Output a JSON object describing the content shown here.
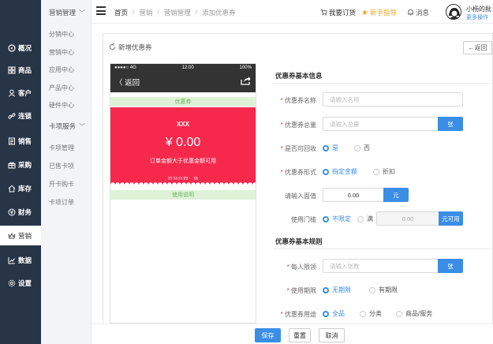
{
  "sidebar": {
    "items": [
      {
        "label": "概况",
        "icon": "compass-icon"
      },
      {
        "label": "商品",
        "icon": "grid-icon"
      },
      {
        "label": "客户",
        "icon": "user-icon"
      },
      {
        "label": "连锁",
        "icon": "link-icon"
      },
      {
        "label": "销售",
        "icon": "document-icon"
      },
      {
        "label": "采购",
        "icon": "gift-icon"
      },
      {
        "label": "库存",
        "icon": "home-icon"
      },
      {
        "label": "财务",
        "icon": "yen-icon"
      },
      {
        "label": "营销",
        "icon": "crown-icon"
      },
      {
        "label": "数据",
        "icon": "chart-icon"
      },
      {
        "label": "设置",
        "icon": "gear-icon"
      }
    ]
  },
  "subnav": {
    "group1": "营销管理",
    "group1_items": [
      "分销中心",
      "营销中心",
      "应用中心",
      "产品中心",
      "硬件中心"
    ],
    "group2": "卡项服务",
    "group2_items": [
      "卡项管理",
      "已售卡项",
      "开卡购卡",
      "卡项订单"
    ]
  },
  "topbar": {
    "breadcrumb": [
      "首页",
      "营销",
      "营销管理",
      "添加优惠券"
    ],
    "order_link": "我要订货",
    "guide_link": "新手指导",
    "message": "消息",
    "username": "小杨的批",
    "more_actions": "更多操作"
  },
  "card": {
    "title": "新增优惠券",
    "back_label": "←返回"
  },
  "phone": {
    "signal": "●●●●○ 4G",
    "time": "12:00",
    "battery": "100%",
    "back": "返回",
    "band_top": "优惠券",
    "coupon_name": "XXX",
    "coupon_amount": "¥ 0.00",
    "coupon_desc": "订单金额大于优惠金额可用",
    "valid_label": "有效日期：至",
    "band_bottom": "使用说明"
  },
  "form": {
    "section1": "优惠券基本信息",
    "name_label": "优惠券名称",
    "name_placeholder": "请输入名称",
    "total_label": "优惠券总量",
    "total_placeholder": "请输入总量",
    "total_unit": "张",
    "recycle_label": "是否可回收",
    "recycle_options": [
      "是",
      "否"
    ],
    "form_label": "优惠券形式",
    "form_options": [
      "指定金额",
      "折扣"
    ],
    "value_label": "请输入面值",
    "value_value": "0.00",
    "value_unit": "元",
    "threshold_label": "使用门槛",
    "threshold_options": [
      "不限定",
      "满"
    ],
    "threshold_value": "0.00",
    "threshold_unit": "元可用",
    "section2": "优惠券基本规则",
    "limit_label": "每人限领",
    "limit_placeholder": "请输入张数",
    "limit_unit": "张",
    "period_label": "使用期限",
    "period_options": [
      "无期限",
      "有期限"
    ],
    "scope_label": "优惠券用途",
    "scope_options": [
      "全品",
      "分类",
      "商品/服务"
    ]
  },
  "footer": {
    "save": "保存",
    "reset": "重置",
    "cancel": "取消"
  },
  "colors": {
    "sidebar": "#283547",
    "accent": "#3a8ee6",
    "coupon": "#f6294d",
    "band": "#dff2d8"
  }
}
